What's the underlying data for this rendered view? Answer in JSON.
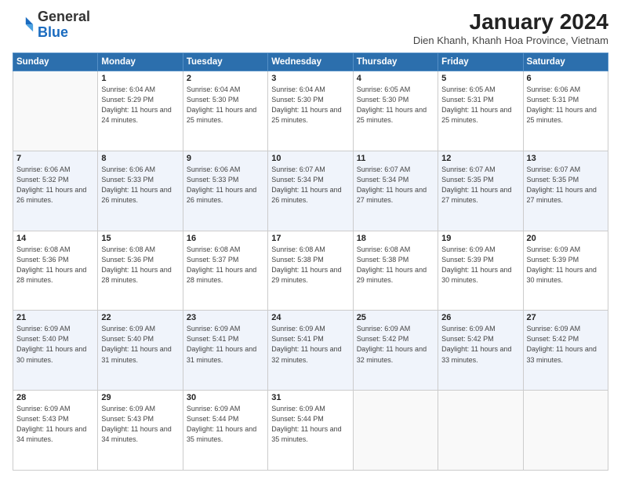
{
  "logo": {
    "general": "General",
    "blue": "Blue"
  },
  "header": {
    "month": "January 2024",
    "location": "Dien Khanh, Khanh Hoa Province, Vietnam"
  },
  "days": [
    "Sunday",
    "Monday",
    "Tuesday",
    "Wednesday",
    "Thursday",
    "Friday",
    "Saturday"
  ],
  "weeks": [
    [
      {
        "num": "",
        "sunrise": "",
        "sunset": "",
        "daylight": ""
      },
      {
        "num": "1",
        "sunrise": "Sunrise: 6:04 AM",
        "sunset": "Sunset: 5:29 PM",
        "daylight": "Daylight: 11 hours and 24 minutes."
      },
      {
        "num": "2",
        "sunrise": "Sunrise: 6:04 AM",
        "sunset": "Sunset: 5:30 PM",
        "daylight": "Daylight: 11 hours and 25 minutes."
      },
      {
        "num": "3",
        "sunrise": "Sunrise: 6:04 AM",
        "sunset": "Sunset: 5:30 PM",
        "daylight": "Daylight: 11 hours and 25 minutes."
      },
      {
        "num": "4",
        "sunrise": "Sunrise: 6:05 AM",
        "sunset": "Sunset: 5:30 PM",
        "daylight": "Daylight: 11 hours and 25 minutes."
      },
      {
        "num": "5",
        "sunrise": "Sunrise: 6:05 AM",
        "sunset": "Sunset: 5:31 PM",
        "daylight": "Daylight: 11 hours and 25 minutes."
      },
      {
        "num": "6",
        "sunrise": "Sunrise: 6:06 AM",
        "sunset": "Sunset: 5:31 PM",
        "daylight": "Daylight: 11 hours and 25 minutes."
      }
    ],
    [
      {
        "num": "7",
        "sunrise": "Sunrise: 6:06 AM",
        "sunset": "Sunset: 5:32 PM",
        "daylight": "Daylight: 11 hours and 26 minutes."
      },
      {
        "num": "8",
        "sunrise": "Sunrise: 6:06 AM",
        "sunset": "Sunset: 5:33 PM",
        "daylight": "Daylight: 11 hours and 26 minutes."
      },
      {
        "num": "9",
        "sunrise": "Sunrise: 6:06 AM",
        "sunset": "Sunset: 5:33 PM",
        "daylight": "Daylight: 11 hours and 26 minutes."
      },
      {
        "num": "10",
        "sunrise": "Sunrise: 6:07 AM",
        "sunset": "Sunset: 5:34 PM",
        "daylight": "Daylight: 11 hours and 26 minutes."
      },
      {
        "num": "11",
        "sunrise": "Sunrise: 6:07 AM",
        "sunset": "Sunset: 5:34 PM",
        "daylight": "Daylight: 11 hours and 27 minutes."
      },
      {
        "num": "12",
        "sunrise": "Sunrise: 6:07 AM",
        "sunset": "Sunset: 5:35 PM",
        "daylight": "Daylight: 11 hours and 27 minutes."
      },
      {
        "num": "13",
        "sunrise": "Sunrise: 6:07 AM",
        "sunset": "Sunset: 5:35 PM",
        "daylight": "Daylight: 11 hours and 27 minutes."
      }
    ],
    [
      {
        "num": "14",
        "sunrise": "Sunrise: 6:08 AM",
        "sunset": "Sunset: 5:36 PM",
        "daylight": "Daylight: 11 hours and 28 minutes."
      },
      {
        "num": "15",
        "sunrise": "Sunrise: 6:08 AM",
        "sunset": "Sunset: 5:36 PM",
        "daylight": "Daylight: 11 hours and 28 minutes."
      },
      {
        "num": "16",
        "sunrise": "Sunrise: 6:08 AM",
        "sunset": "Sunset: 5:37 PM",
        "daylight": "Daylight: 11 hours and 28 minutes."
      },
      {
        "num": "17",
        "sunrise": "Sunrise: 6:08 AM",
        "sunset": "Sunset: 5:38 PM",
        "daylight": "Daylight: 11 hours and 29 minutes."
      },
      {
        "num": "18",
        "sunrise": "Sunrise: 6:08 AM",
        "sunset": "Sunset: 5:38 PM",
        "daylight": "Daylight: 11 hours and 29 minutes."
      },
      {
        "num": "19",
        "sunrise": "Sunrise: 6:09 AM",
        "sunset": "Sunset: 5:39 PM",
        "daylight": "Daylight: 11 hours and 30 minutes."
      },
      {
        "num": "20",
        "sunrise": "Sunrise: 6:09 AM",
        "sunset": "Sunset: 5:39 PM",
        "daylight": "Daylight: 11 hours and 30 minutes."
      }
    ],
    [
      {
        "num": "21",
        "sunrise": "Sunrise: 6:09 AM",
        "sunset": "Sunset: 5:40 PM",
        "daylight": "Daylight: 11 hours and 30 minutes."
      },
      {
        "num": "22",
        "sunrise": "Sunrise: 6:09 AM",
        "sunset": "Sunset: 5:40 PM",
        "daylight": "Daylight: 11 hours and 31 minutes."
      },
      {
        "num": "23",
        "sunrise": "Sunrise: 6:09 AM",
        "sunset": "Sunset: 5:41 PM",
        "daylight": "Daylight: 11 hours and 31 minutes."
      },
      {
        "num": "24",
        "sunrise": "Sunrise: 6:09 AM",
        "sunset": "Sunset: 5:41 PM",
        "daylight": "Daylight: 11 hours and 32 minutes."
      },
      {
        "num": "25",
        "sunrise": "Sunrise: 6:09 AM",
        "sunset": "Sunset: 5:42 PM",
        "daylight": "Daylight: 11 hours and 32 minutes."
      },
      {
        "num": "26",
        "sunrise": "Sunrise: 6:09 AM",
        "sunset": "Sunset: 5:42 PM",
        "daylight": "Daylight: 11 hours and 33 minutes."
      },
      {
        "num": "27",
        "sunrise": "Sunrise: 6:09 AM",
        "sunset": "Sunset: 5:42 PM",
        "daylight": "Daylight: 11 hours and 33 minutes."
      }
    ],
    [
      {
        "num": "28",
        "sunrise": "Sunrise: 6:09 AM",
        "sunset": "Sunset: 5:43 PM",
        "daylight": "Daylight: 11 hours and 34 minutes."
      },
      {
        "num": "29",
        "sunrise": "Sunrise: 6:09 AM",
        "sunset": "Sunset: 5:43 PM",
        "daylight": "Daylight: 11 hours and 34 minutes."
      },
      {
        "num": "30",
        "sunrise": "Sunrise: 6:09 AM",
        "sunset": "Sunset: 5:44 PM",
        "daylight": "Daylight: 11 hours and 35 minutes."
      },
      {
        "num": "31",
        "sunrise": "Sunrise: 6:09 AM",
        "sunset": "Sunset: 5:44 PM",
        "daylight": "Daylight: 11 hours and 35 minutes."
      },
      {
        "num": "",
        "sunrise": "",
        "sunset": "",
        "daylight": ""
      },
      {
        "num": "",
        "sunrise": "",
        "sunset": "",
        "daylight": ""
      },
      {
        "num": "",
        "sunrise": "",
        "sunset": "",
        "daylight": ""
      }
    ]
  ]
}
